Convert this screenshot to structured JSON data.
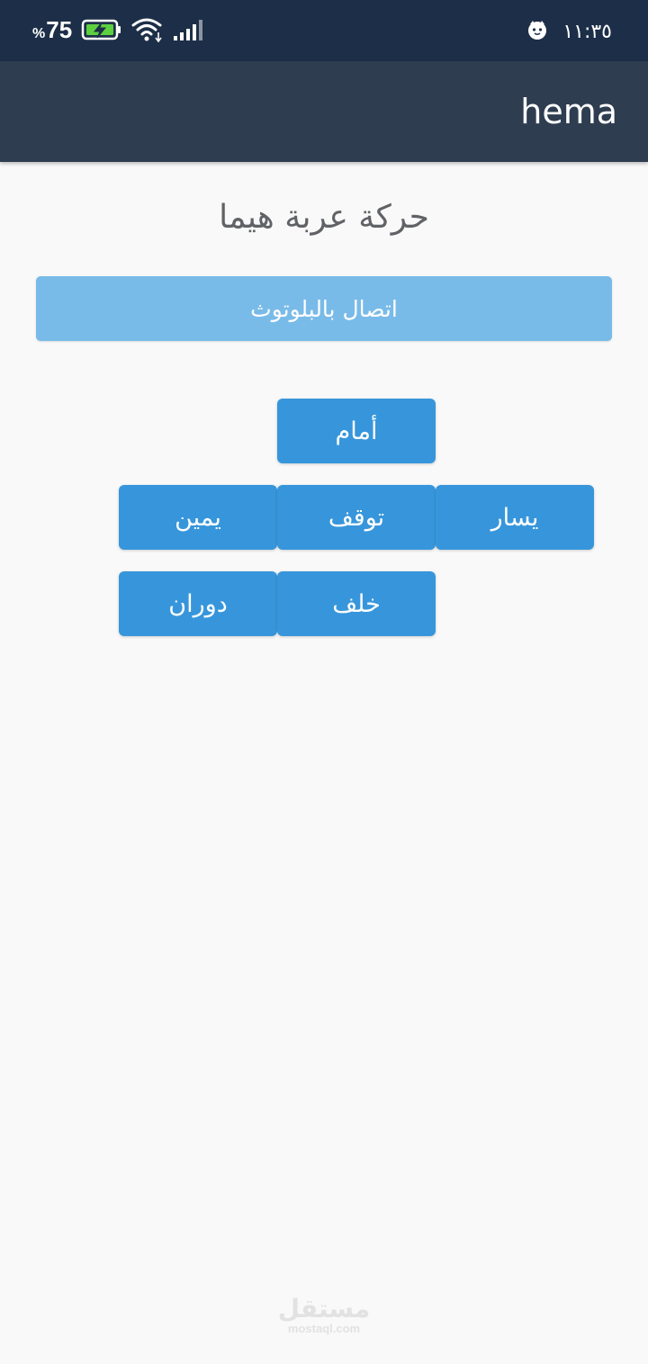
{
  "status_bar": {
    "battery_level": "75",
    "battery_percent_sign": "%",
    "battery_icon": "battery-charging-icon",
    "wifi_icon": "wifi-icon",
    "signal_icon": "signal-bars-icon",
    "notification_icon": "cat-face-icon",
    "clock": "١١:٣٥"
  },
  "app_bar": {
    "title": "hema"
  },
  "main": {
    "heading": "حركة عربة هيما",
    "bluetooth_button": "اتصال بالبلوتوث",
    "controls": {
      "forward": "أمام",
      "left": "يسار",
      "stop": "توقف",
      "right": "يمين",
      "backward": "خلف",
      "rotate": "دوران"
    }
  },
  "watermark": {
    "arabic": "مستقل",
    "latin": "mostaql.com"
  },
  "colors": {
    "status_bar_bg": "#1d2f48",
    "app_bar_bg": "#2e3d50",
    "page_bg": "#f9f9f9",
    "bluetooth_button_bg": "#79bbe8",
    "control_button_bg": "#3796db",
    "heading_text": "#606266",
    "battery_charge": "#5cd03e"
  }
}
